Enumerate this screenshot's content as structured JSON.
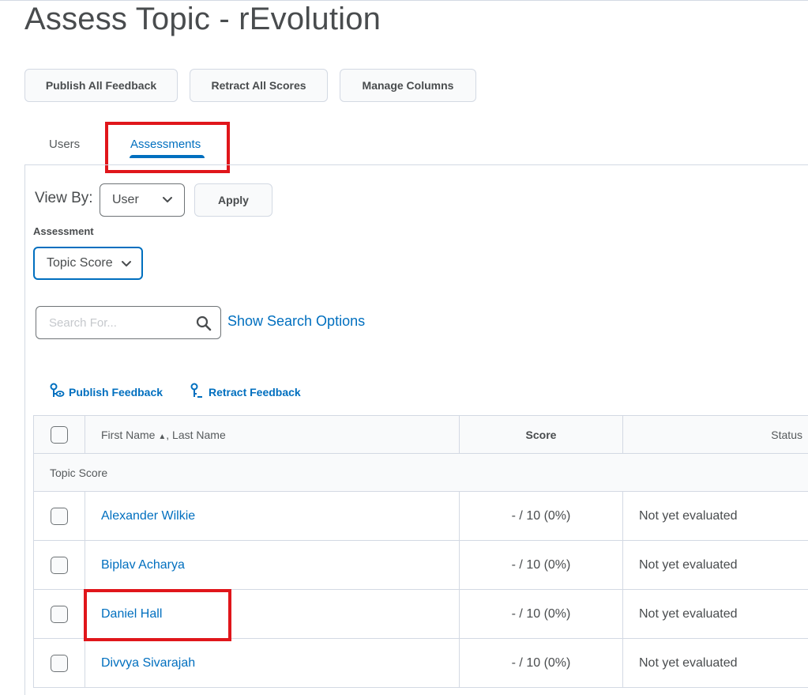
{
  "page": {
    "title": "Assess Topic - rEvolution"
  },
  "toolbar": {
    "publish_all_feedback": "Publish All Feedback",
    "retract_all_scores": "Retract All Scores",
    "manage_columns": "Manage Columns"
  },
  "tabs": [
    {
      "label": "Users",
      "active": false
    },
    {
      "label": "Assessments",
      "active": true
    }
  ],
  "view_by": {
    "label": "View By:",
    "selected": "User",
    "apply_label": "Apply"
  },
  "assessment": {
    "label": "Assessment",
    "selected": "Topic Score"
  },
  "search": {
    "placeholder": "Search For...",
    "show_options_label": "Show Search Options"
  },
  "actions": {
    "publish_feedback": "Publish Feedback",
    "retract_feedback": "Retract Feedback"
  },
  "table": {
    "headers": {
      "name_first": "First Name",
      "name_last": ", Last Name",
      "score": "Score",
      "status": "Status"
    },
    "section_label": "Topic Score",
    "rows": [
      {
        "name": "Alexander Wilkie",
        "score": "- / 10 (0%)",
        "status": "Not yet evaluated"
      },
      {
        "name": "Biplav Acharya",
        "score": "- / 10 (0%)",
        "status": "Not yet evaluated"
      },
      {
        "name": "Daniel Hall",
        "score": "- / 10 (0%)",
        "status": "Not yet evaluated"
      },
      {
        "name": "Divvya Sivarajah",
        "score": "- / 10 (0%)",
        "status": "Not yet evaluated"
      }
    ]
  },
  "colors": {
    "accent": "#006fbf",
    "highlight": "#e0161b",
    "text": "#494c4e",
    "border": "#d3d9e3"
  },
  "icons": [
    "chevron-down-icon",
    "search-icon",
    "publish-feedback-icon",
    "retract-feedback-icon",
    "sort-ascending-icon"
  ]
}
